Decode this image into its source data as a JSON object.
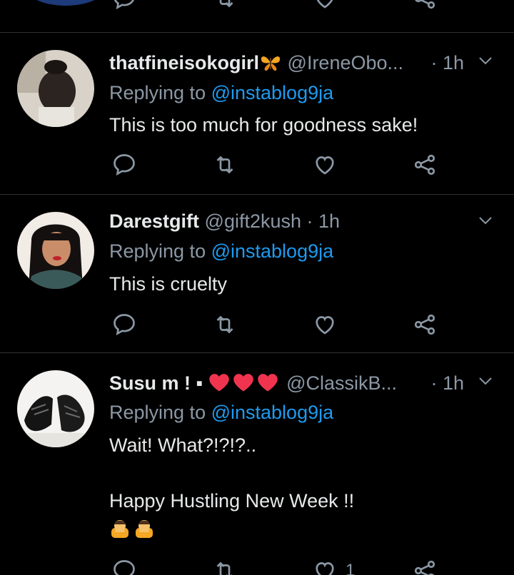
{
  "tweets": [
    {
      "display_name": "thatfineisokogirl",
      "handle": "@IreneObo...",
      "time": "· 1h",
      "replying_prefix": "Replying to ",
      "replying_to": "@instablog9ja",
      "text_lines": [
        "This is too much for goodness sake!"
      ]
    },
    {
      "display_name": "Darestgift",
      "handle": "@gift2kush",
      "time": "· 1h",
      "replying_prefix": "Replying to ",
      "replying_to": "@instablog9ja",
      "text_lines": [
        "This is cruelty"
      ]
    },
    {
      "display_name": "Susu m ! ▪",
      "handle": "@ClassikB...",
      "time": "· 1h",
      "replying_prefix": "Replying to ",
      "replying_to": "@instablog9ja",
      "text_lines": [
        "Wait! What?!?!?..",
        "Happy Hustling New Week !!"
      ],
      "like_count": "1"
    }
  ],
  "colors": {
    "background": "#000000",
    "divider": "#2f3336",
    "secondary_text": "#8b98a5",
    "primary_text": "#e7e9ea",
    "mention": "#1d9bf0",
    "heart_emoji": "#f0344f"
  },
  "icons": [
    "reply-icon",
    "retweet-icon",
    "like-icon",
    "share-icon",
    "chevron-down-icon",
    "butterfly-emoji",
    "heart-emoji",
    "person-bowing-emoji"
  ]
}
